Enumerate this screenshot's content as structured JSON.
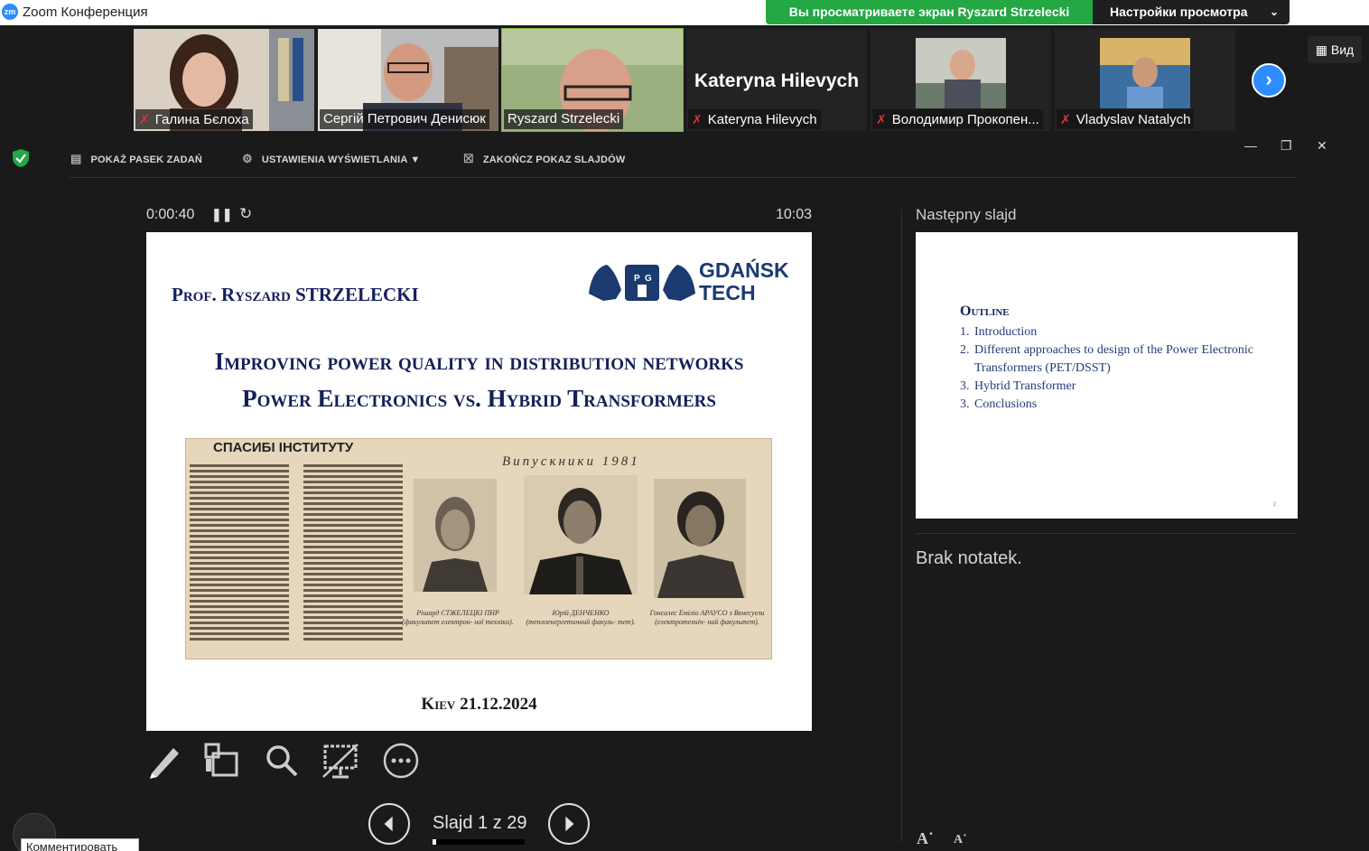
{
  "titlebar": {
    "app_icon": "zm",
    "app_title": "Zoom Конференция",
    "share_banner": "Вы просматриваете экран Ryszard Strzelecki",
    "view_settings": "Настройки просмотра"
  },
  "participants": [
    {
      "name": "Галина Бєлоха",
      "muted": true
    },
    {
      "name": "Сергій Петрович Денисюк",
      "muted": false
    },
    {
      "name": "Ryszard Strzelecki",
      "muted": false,
      "active": true
    },
    {
      "name": "Kateryna Hilevych",
      "muted": true,
      "display_name": "Kateryna Hilevych"
    },
    {
      "name": "Володимир Прокопен...",
      "muted": true
    },
    {
      "name": "Vladyslav Natalych",
      "muted": true
    }
  ],
  "view_button": "Вид",
  "toolbar": {
    "show_taskbar": "POKAŻ PASEK ZADAŃ",
    "display_settings": "USTAWIENIA WYŚWIETLANIA ▼",
    "end_show": "ZAKOŃCZ POKAZ SLAJDÓW"
  },
  "presenter": {
    "elapsed": "0:00:40",
    "clock": "10:03",
    "slide_counter": "Slajd 1 z 29",
    "current_slide_index": 1,
    "total_slides": 29
  },
  "slide": {
    "author": "Prof. Ryszard STRZELECKI",
    "logo_line1": "GDAŃSK",
    "logo_line2": "TECH",
    "title_line1": "Improving power quality in distribution networks",
    "title_line2": "Power Electronics vs. Hybrid Transformers",
    "clipping_head": "СПАСИБІ ІНСТИТУТУ",
    "clipping_grads": "Випускники 1981",
    "caption_1": "Рішард СТЖЕЛЕЦКІ ПНР (факультет електрон- ної техніки).",
    "caption_2": "Юрій ДЕНЧЕНКО (теплоенергетичний факуль- тет).",
    "caption_3": "Гонсалес Еміліо АРАУСО з Венесуели (електротехніч- ний факультет).",
    "footer": "Kiev 21.12.2024"
  },
  "next_slide": {
    "label": "Następny slajd",
    "outline_title": "Outline",
    "items": [
      {
        "num": "1.",
        "text": "Introduction"
      },
      {
        "num": "2.",
        "text": "Different approaches to design of the Power Electronic Transformers (PET/DSST)"
      },
      {
        "num": "3.",
        "text": "Hybrid Transformer"
      },
      {
        "num": "3.",
        "text": "Conclusions"
      }
    ],
    "page_number": "2"
  },
  "notes": "Brak notatek.",
  "comment_button": "Комментировать",
  "colors": {
    "share_banner": "#23a844",
    "accent_blue": "#2d8cff",
    "slide_title": "#142058"
  }
}
